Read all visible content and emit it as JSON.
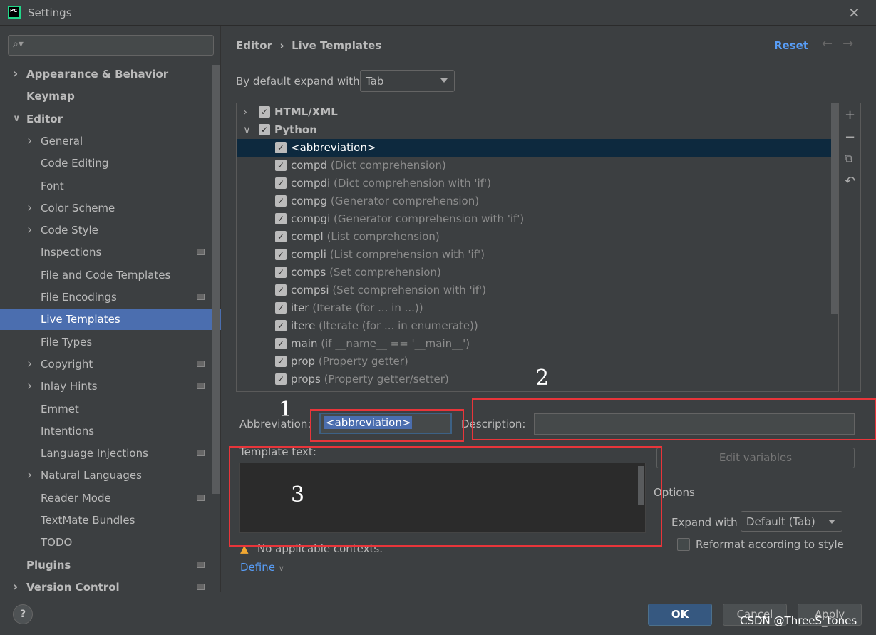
{
  "window": {
    "title": "Settings",
    "logo": "PC",
    "close_icon": "close-icon"
  },
  "sidebar": {
    "search_placeholder": "",
    "items": [
      {
        "label": "Appearance & Behavior",
        "level": 0,
        "bold": true,
        "chevron": "right"
      },
      {
        "label": "Keymap",
        "level": 0,
        "bold": true
      },
      {
        "label": "Editor",
        "level": 0,
        "bold": true,
        "chevron": "down"
      },
      {
        "label": "General",
        "level": 1,
        "chevron": "right"
      },
      {
        "label": "Code Editing",
        "level": 1
      },
      {
        "label": "Font",
        "level": 1
      },
      {
        "label": "Color Scheme",
        "level": 1,
        "chevron": "right"
      },
      {
        "label": "Code Style",
        "level": 1,
        "chevron": "right"
      },
      {
        "label": "Inspections",
        "level": 1,
        "project": true
      },
      {
        "label": "File and Code Templates",
        "level": 1
      },
      {
        "label": "File Encodings",
        "level": 1,
        "project": true
      },
      {
        "label": "Live Templates",
        "level": 1,
        "selected": true
      },
      {
        "label": "File Types",
        "level": 1
      },
      {
        "label": "Copyright",
        "level": 1,
        "chevron": "right",
        "project": true
      },
      {
        "label": "Inlay Hints",
        "level": 1,
        "chevron": "right",
        "project": true
      },
      {
        "label": "Emmet",
        "level": 1
      },
      {
        "label": "Intentions",
        "level": 1
      },
      {
        "label": "Language Injections",
        "level": 1,
        "project": true
      },
      {
        "label": "Natural Languages",
        "level": 1,
        "chevron": "right"
      },
      {
        "label": "Reader Mode",
        "level": 1,
        "project": true
      },
      {
        "label": "TextMate Bundles",
        "level": 1
      },
      {
        "label": "TODO",
        "level": 1
      },
      {
        "label": "Plugins",
        "level": 0,
        "bold": true,
        "project": true
      },
      {
        "label": "Version Control",
        "level": 0,
        "bold": true,
        "chevron": "right",
        "project": true
      }
    ]
  },
  "main": {
    "breadcrumb": [
      "Editor",
      "Live Templates"
    ],
    "breadcrumb_sep": "›",
    "reset_label": "Reset",
    "expand_label": "By default expand with",
    "expand_value": "Tab",
    "groups": [
      {
        "name": "HTML/XML",
        "checked": true,
        "expanded": false
      },
      {
        "name": "Python",
        "checked": true,
        "expanded": true
      }
    ],
    "templates": [
      {
        "abbr": "<abbreviation>",
        "desc": "",
        "selected": true
      },
      {
        "abbr": "compd",
        "desc": "(Dict comprehension)"
      },
      {
        "abbr": "compdi",
        "desc": "(Dict comprehension with 'if')"
      },
      {
        "abbr": "compg",
        "desc": "(Generator comprehension)"
      },
      {
        "abbr": "compgi",
        "desc": "(Generator comprehension with 'if')"
      },
      {
        "abbr": "compl",
        "desc": "(List comprehension)"
      },
      {
        "abbr": "compli",
        "desc": "(List comprehension with 'if')"
      },
      {
        "abbr": "comps",
        "desc": "(Set comprehension)"
      },
      {
        "abbr": "compsi",
        "desc": "(Set comprehension with 'if')"
      },
      {
        "abbr": "iter",
        "desc": "(Iterate (for ... in ...))"
      },
      {
        "abbr": "itere",
        "desc": "(Iterate (for ... in enumerate))"
      },
      {
        "abbr": "main",
        "desc": "(if __name__ == '__main__')"
      },
      {
        "abbr": "prop",
        "desc": "(Property getter)"
      },
      {
        "abbr": "props",
        "desc": "(Property getter/setter)"
      }
    ],
    "tools": [
      "+",
      "−",
      "⧉",
      "↶"
    ],
    "abbreviation_label": "Abbreviation:",
    "abbreviation_value": "<abbreviation>",
    "description_label": "Description:",
    "description_value": "",
    "template_text_label": "Template text:",
    "template_text_value": "",
    "edit_variables_label": "Edit variables",
    "options_label": "Options",
    "expand_with_label": "Expand with",
    "expand_with_value": "Default (Tab)",
    "reformat_label": "Reformat according to style",
    "reformat_checked": false,
    "warning_text": "No applicable contexts.",
    "define_label": "Define"
  },
  "annotations": {
    "mark1": "1",
    "mark2": "2",
    "mark3": "3",
    "color": "#e8353a"
  },
  "footer": {
    "help": "?",
    "ok": "OK",
    "cancel": "Cancel",
    "apply": "Apply"
  },
  "watermark": "CSDN @ThreeS_tones"
}
